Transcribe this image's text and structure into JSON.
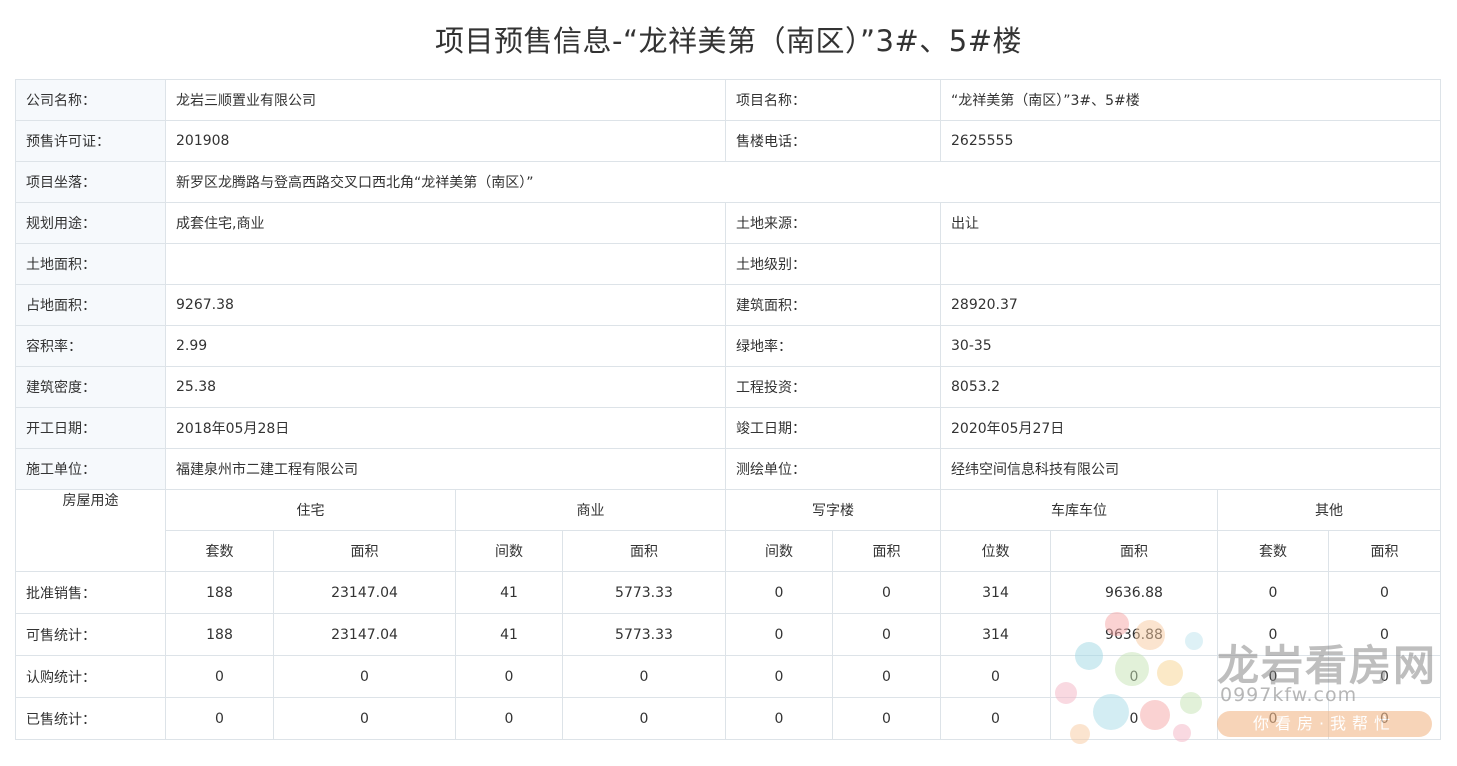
{
  "title": "项目预售信息-“龙祥美第（南区）”3#、5#楼",
  "info": {
    "company_label": "公司名称：",
    "company_value": "龙岩三顺置业有限公司",
    "project_label": "项目名称：",
    "project_value": "“龙祥美第（南区）”3#、5#楼",
    "permit_label": "预售许可证：",
    "permit_value": "201908",
    "phone_label": "售楼电话：",
    "phone_value": "2625555",
    "location_label": "项目坐落：",
    "location_value": "新罗区龙腾路与登高西路交叉口西北角“龙祥美第（南区）”",
    "use_label": "规划用途：",
    "use_value": "成套住宅,商业",
    "land_source_label": "土地来源：",
    "land_source_value": "出让",
    "land_area_label": "土地面积：",
    "land_area_value": "",
    "land_grade_label": "土地级别：",
    "land_grade_value": "",
    "footprint_label": "占地面积：",
    "footprint_value": "9267.38",
    "building_area_label": "建筑面积：",
    "building_area_value": "28920.37",
    "far_label": "容积率：",
    "far_value": "2.99",
    "green_label": "绿地率：",
    "green_value": "30-35",
    "density_label": "建筑密度：",
    "density_value": "25.38",
    "investment_label": "工程投资：",
    "investment_value": "8053.2",
    "start_label": "开工日期：",
    "start_value": "2018年05月28日",
    "finish_label": "竣工日期：",
    "finish_value": "2020年05月27日",
    "builder_label": "施工单位：",
    "builder_value": "福建泉州市二建工程有限公司",
    "surveyor_label": "测绘单位：",
    "surveyor_value": "经纬空间信息科技有限公司"
  },
  "stats": {
    "usage_label": "房屋用途",
    "groups": [
      "住宅",
      "商业",
      "写字楼",
      "车库车位",
      "其他"
    ],
    "subheaders": [
      "套数",
      "面积",
      "间数",
      "面积",
      "间数",
      "面积",
      "位数",
      "面积",
      "套数",
      "面积"
    ],
    "rows": [
      {
        "label": "批准销售：",
        "values": [
          "188",
          "23147.04",
          "41",
          "5773.33",
          "0",
          "0",
          "314",
          "9636.88",
          "0",
          "0"
        ]
      },
      {
        "label": "可售统计：",
        "values": [
          "188",
          "23147.04",
          "41",
          "5773.33",
          "0",
          "0",
          "314",
          "9636.88",
          "0",
          "0"
        ]
      },
      {
        "label": "认购统计：",
        "values": [
          "0",
          "0",
          "0",
          "0",
          "0",
          "0",
          "0",
          "0",
          "0",
          "0"
        ]
      },
      {
        "label": "已售统计：",
        "values": [
          "0",
          "0",
          "0",
          "0",
          "0",
          "0",
          "0",
          "0",
          "0",
          "0"
        ]
      }
    ]
  },
  "watermark": {
    "brand": "龙岩看房网",
    "url": "0997kfw.com",
    "slogan": "你看房·我帮忙"
  }
}
